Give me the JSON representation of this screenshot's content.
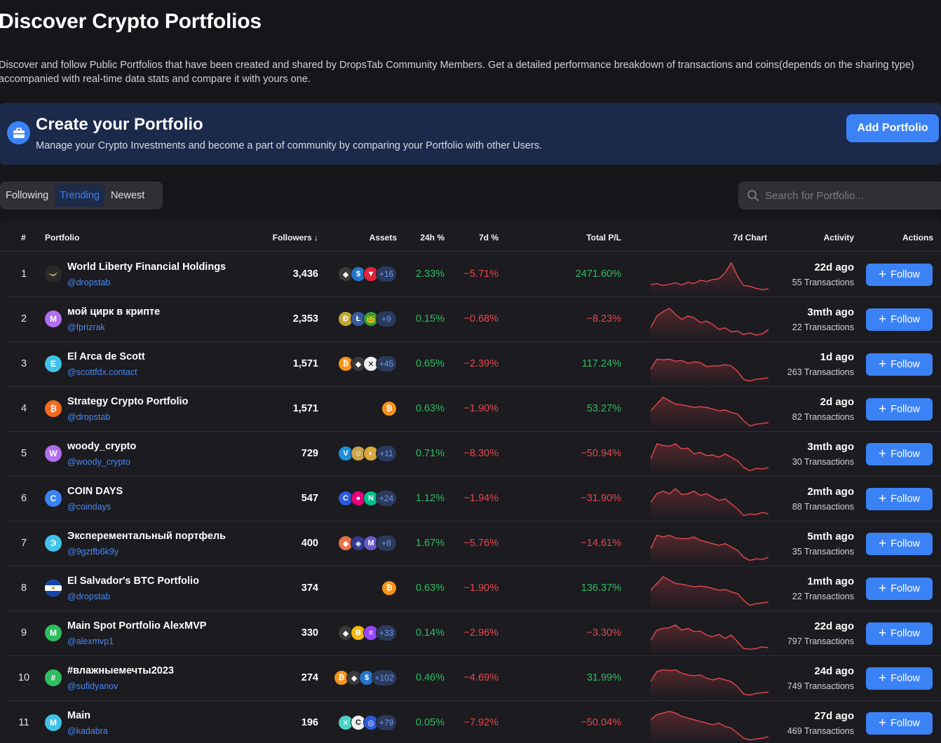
{
  "page": {
    "title": "Discover Crypto Portfolios",
    "description": "Discover and follow Public Portfolios that have been created and shared by DropsTab Community Members. Get a detailed performance breakdown of transactions and coins(depends on the sharing type) accompanied with real-time data stats and compare it with yours one."
  },
  "banner": {
    "icon": "briefcase-icon",
    "title": "Create your Portfolio",
    "subtitle": "Manage your Crypto Investments and become a part of community by comparing your Portfolio with other Users.",
    "button_label": "Add Portfolio"
  },
  "tabs": [
    {
      "label": "Following",
      "active": false
    },
    {
      "label": "Trending",
      "active": true
    },
    {
      "label": "Newest",
      "active": false
    }
  ],
  "search": {
    "placeholder": "Search for Portfolio..."
  },
  "table": {
    "headers": {
      "rank": "#",
      "portfolio": "Portfolio",
      "followers": "Followers ↓",
      "assets": "Assets",
      "h24": "24h %",
      "d7": "7d %",
      "pnl": "Total P/L",
      "chart": "7d Chart",
      "activity": "Activity",
      "actions": "Actions"
    },
    "follow_label": "Follow",
    "rows": [
      {
        "rank": "1",
        "name": "World Liberty Financial Holdings",
        "handle": "@dropstab",
        "avatar": "",
        "avatar_color": "#2a2a2a",
        "followers": "3,436",
        "coins": [
          {
            "l": "◆",
            "c": "#3a3a3a"
          },
          {
            "l": "$",
            "c": "#2775ca"
          },
          {
            "l": "▼",
            "c": "#e0243a"
          }
        ],
        "more": "+16",
        "h24": "2.33%",
        "d7": "−5.71%",
        "pnl": "2471.60%",
        "pnl_up": true,
        "time": "22d ago",
        "tx": "55 Transactions"
      },
      {
        "rank": "2",
        "name": "мой цирк в крипте",
        "handle": "@fprizrak",
        "avatar": "M",
        "avatar_color": "#b26df0",
        "followers": "2,353",
        "coins": [
          {
            "l": "Ð",
            "c": "#c2a633"
          },
          {
            "l": "Ł",
            "c": "#345d9d"
          },
          {
            "l": "🐸",
            "c": "#3a9a3a"
          }
        ],
        "more": "+9",
        "h24": "0.15%",
        "d7": "−0.68%",
        "pnl": "−8.23%",
        "pnl_up": false,
        "time": "3mth ago",
        "tx": "22 Transactions"
      },
      {
        "rank": "3",
        "name": "El Arca de Scott",
        "handle": "@scottfdx.contact",
        "avatar": "E",
        "avatar_color": "#3fc3e8",
        "followers": "1,571",
        "coins": [
          {
            "l": "₿",
            "c": "#f7931a"
          },
          {
            "l": "◆",
            "c": "#3a3a3a"
          },
          {
            "l": "✕",
            "c": "#f0f0f0"
          }
        ],
        "more": "+45",
        "h24": "0.65%",
        "d7": "−2.39%",
        "pnl": "117.24%",
        "pnl_up": true,
        "time": "1d ago",
        "tx": "263 Transactions"
      },
      {
        "rank": "4",
        "name": "Strategy Crypto Portfolio",
        "handle": "@dropstab",
        "avatar": "₿",
        "avatar_color": "#f26b1d",
        "followers": "1,571",
        "coins": [
          {
            "l": "₿",
            "c": "#f7931a"
          }
        ],
        "more": "",
        "h24": "0.63%",
        "d7": "−1.90%",
        "pnl": "53.27%",
        "pnl_up": true,
        "time": "2d ago",
        "tx": "82 Transactions"
      },
      {
        "rank": "5",
        "name": "woody_crypto",
        "handle": "@woody_crypto",
        "avatar": "W",
        "avatar_color": "#b26df0",
        "followers": "729",
        "coins": [
          {
            "l": "V",
            "c": "#1d8fd8"
          },
          {
            "l": "☺",
            "c": "#c9a24b"
          },
          {
            "l": "◐",
            "c": "#d8a83a"
          }
        ],
        "more": "+11",
        "h24": "0.71%",
        "d7": "−8.30%",
        "pnl": "−50.94%",
        "pnl_up": false,
        "time": "3mth ago",
        "tx": "30 Transactions"
      },
      {
        "rank": "6",
        "name": "COIN DAYS",
        "handle": "@coindays",
        "avatar": "C",
        "avatar_color": "#3b82f6",
        "followers": "547",
        "coins": [
          {
            "l": "C",
            "c": "#2a5ada"
          },
          {
            "l": "●",
            "c": "#e6007a"
          },
          {
            "l": "N",
            "c": "#00c08b"
          }
        ],
        "more": "+24",
        "h24": "1.12%",
        "d7": "−1.94%",
        "pnl": "−31.90%",
        "pnl_up": false,
        "time": "2mth ago",
        "tx": "88 Transactions"
      },
      {
        "rank": "7",
        "name": "Эксперементальный портфель",
        "handle": "@9gztfb6k9y",
        "avatar": "Э",
        "avatar_color": "#3fc3e8",
        "followers": "400",
        "coins": [
          {
            "l": "◆",
            "c": "#e8734a"
          },
          {
            "l": "◈",
            "c": "#2e3a8c"
          },
          {
            "l": "M",
            "c": "#6a5acd"
          }
        ],
        "more": "+8",
        "h24": "1.67%",
        "d7": "−5.76%",
        "pnl": "−14.61%",
        "pnl_up": false,
        "time": "5mth ago",
        "tx": "35 Transactions"
      },
      {
        "rank": "8",
        "name": "El Salvador's BTC Portfolio",
        "handle": "@dropstab",
        "avatar": "",
        "avatar_color": "#ffffff",
        "followers": "374",
        "coins": [
          {
            "l": "₿",
            "c": "#f7931a"
          }
        ],
        "more": "",
        "h24": "0.63%",
        "d7": "−1.90%",
        "pnl": "136.37%",
        "pnl_up": true,
        "time": "1mth ago",
        "tx": "22 Transactions"
      },
      {
        "rank": "9",
        "name": "Main Spot Portfolio AlexMVP",
        "handle": "@alexmvp1",
        "avatar": "M",
        "avatar_color": "#2ebd5f",
        "followers": "330",
        "coins": [
          {
            "l": "◆",
            "c": "#3a3a3a"
          },
          {
            "l": "B",
            "c": "#f0b90b"
          },
          {
            "l": "≡",
            "c": "#9945ff"
          }
        ],
        "more": "+33",
        "h24": "0.14%",
        "d7": "−2.96%",
        "pnl": "−3.30%",
        "pnl_up": false,
        "time": "22d ago",
        "tx": "797 Transactions"
      },
      {
        "rank": "10",
        "name": "#влажныемечты2023",
        "handle": "@sufidyanov",
        "avatar": "#",
        "avatar_color": "#2ebd5f",
        "followers": "274",
        "coins": [
          {
            "l": "₿",
            "c": "#f7931a"
          },
          {
            "l": "◆",
            "c": "#3a3a3a"
          },
          {
            "l": "$",
            "c": "#2775ca"
          }
        ],
        "more": "+102",
        "h24": "0.46%",
        "d7": "−4.69%",
        "pnl": "31.99%",
        "pnl_up": true,
        "time": "24d ago",
        "tx": "749 Transactions"
      },
      {
        "rank": "11",
        "name": "Main",
        "handle": "@kadabra",
        "avatar": "M",
        "avatar_color": "#3fc3e8",
        "followers": "196",
        "coins": [
          {
            "l": "✕",
            "c": "#4fd1c5"
          },
          {
            "l": "C",
            "c": "#f0f0f0"
          },
          {
            "l": "◎",
            "c": "#2a5ada"
          }
        ],
        "more": "+79",
        "h24": "0.05%",
        "d7": "−7.92%",
        "pnl": "−50.04%",
        "pnl_up": false,
        "time": "27d ago",
        "tx": "469 Transactions"
      }
    ]
  },
  "colors": {
    "accent": "#3b82f6",
    "positive": "#2ebd5f",
    "negative": "#e5484d",
    "background": "#16161a",
    "banner": "#1b2a4a"
  }
}
